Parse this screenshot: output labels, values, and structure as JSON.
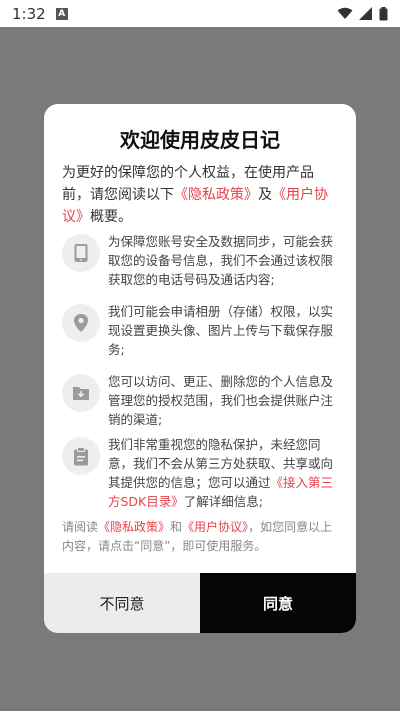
{
  "status_bar": {
    "time": "1:32",
    "notif_icon": "a-box-icon"
  },
  "dialog": {
    "title": "欢迎使用皮皮日记",
    "intro": {
      "part1": "为更好的保障您的个人权益，在使用产品前，请您阅读以下",
      "link1": "《隐私政策》",
      "part2": "及",
      "link2": "《用户协议》",
      "part3": "概要。"
    },
    "items": [
      {
        "icon": "phone-icon",
        "text": "为保障您账号安全及数据同步，可能会获取您的设备号信息，我们不会通过该权限获取您的电话号码及通话内容;"
      },
      {
        "icon": "location-icon",
        "text": "我们可能会申请相册（存储）权限，以实现设置更换头像、图片上传与下载保存服务;"
      },
      {
        "icon": "download-folder-icon",
        "text": "您可以访问、更正、删除您的个人信息及管理您的授权范围，我们也会提供账户注销的渠道;"
      },
      {
        "icon": "clipboard-icon",
        "text_part1": "我们非常重视您的隐私保护，未经您同意，我们不会从第三方处获取、共享或向其提供您的信息；您可以通过",
        "link": "《接入第三方SDK目录》",
        "text_part2": "了解详细信息;"
      }
    ],
    "footer": {
      "part1": "请阅读",
      "link1": "《隐私政策》",
      "part2": "和",
      "link2": "《用户协议》",
      "part3": "，如您同意以上内容，请点击“同意”，即可使用服务。"
    },
    "disagree_label": "不同意",
    "agree_label": "同意"
  },
  "colors": {
    "link": "#e8424b",
    "overlay": "#7a7a7a",
    "agree_bg": "#050505",
    "disagree_bg": "#ececec"
  }
}
